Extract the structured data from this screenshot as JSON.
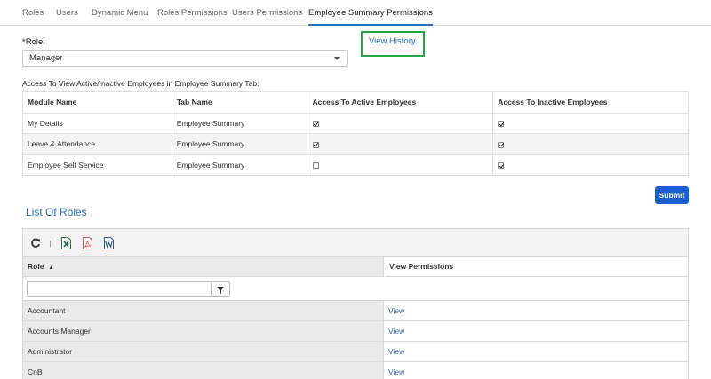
{
  "tabs": [
    {
      "label": "Roles"
    },
    {
      "label": "Users"
    },
    {
      "label": "Dynamic Menu"
    },
    {
      "label": "Roles Permissions"
    },
    {
      "label": "Users Permissions"
    },
    {
      "label": "Employee Summary Permissions",
      "active": true
    }
  ],
  "role": {
    "label": "*Role:",
    "selected": "Manager"
  },
  "view_history": {
    "label": "View History"
  },
  "access": {
    "caption": "Access To View Active/Inactive Employees in Employee Summary Tab:",
    "columns": [
      "Module Name",
      "Tab Name",
      "Access To Active Employees",
      "Access To Inactive Employees"
    ],
    "rows": [
      {
        "module": "My Details",
        "tab": "Employee Summary",
        "active": true,
        "inactive": true
      },
      {
        "module": "Leave & Attendance",
        "tab": "Employee Summary",
        "active": true,
        "inactive": true
      },
      {
        "module": "Employee Self Service",
        "tab": "Employee Summary",
        "active": false,
        "inactive": true
      }
    ]
  },
  "submit_label": "Submit",
  "list_title": "List Of Roles",
  "toolbar": {
    "icons": [
      "refresh-icon",
      "excel-icon",
      "pdf-icon",
      "word-icon"
    ]
  },
  "grid": {
    "columns": {
      "role": "Role",
      "view": "View Permissions"
    },
    "sort_indicator": "▲",
    "filter_value": "",
    "rows": [
      {
        "role": "Accountant",
        "view": "View"
      },
      {
        "role": "Accounts Manager",
        "view": "View"
      },
      {
        "role": "Administrator",
        "view": "View"
      },
      {
        "role": "CnB",
        "view": "View"
      }
    ]
  },
  "colors": {
    "accent": "#2a6ebb",
    "submit": "#1a5fd6",
    "highlight_border": "#28a745",
    "excel": "#1e7145",
    "pdf": "#e2574c",
    "word": "#2b579a"
  }
}
